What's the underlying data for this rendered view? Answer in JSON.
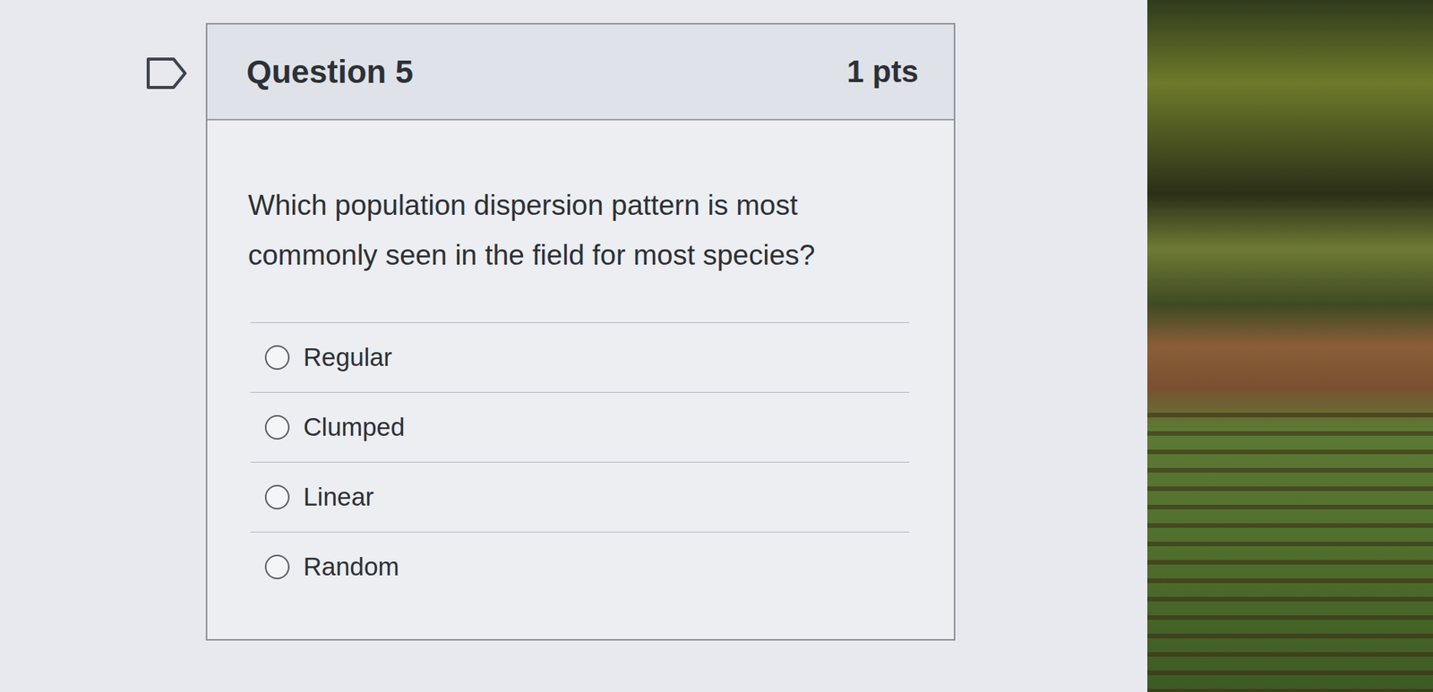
{
  "question": {
    "title": "Question 5",
    "points": "1 pts",
    "text": "Which population dispersion pattern is most commonly seen in the field for most species?",
    "options": [
      {
        "label": "Regular",
        "selected": false
      },
      {
        "label": "Clumped",
        "selected": false
      },
      {
        "label": "Linear",
        "selected": false
      },
      {
        "label": "Random",
        "selected": false
      }
    ]
  }
}
